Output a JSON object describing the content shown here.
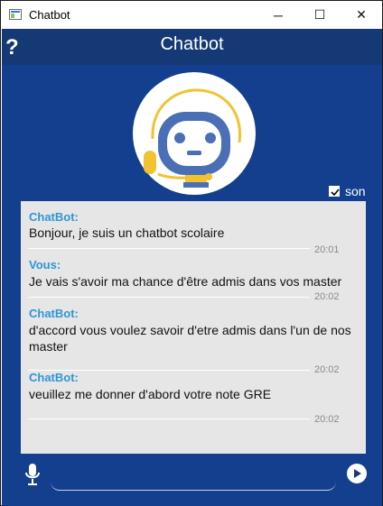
{
  "window": {
    "title": "Chatbot",
    "icon": "app-window-icon",
    "controls": {
      "minimize": "─",
      "maximize": "☐",
      "close": "✕"
    }
  },
  "header": {
    "title": "Chatbot",
    "help_label": "?",
    "background": "#153975"
  },
  "avatar": {
    "icon": "robot-headset-icon"
  },
  "sound": {
    "label": "son",
    "checked": true
  },
  "messages": [
    {
      "sender": "ChatBot:",
      "text": "Bonjour, je suis un chatbot scolaire",
      "time": "20:01"
    },
    {
      "sender": "Vous:",
      "text": "Je vais s'avoir ma chance d'être admis dans vos master",
      "time": "20:02"
    },
    {
      "sender": "ChatBot:",
      "text": "d'accord vous voulez savoir d'etre admis dans l'un de nos master",
      "time": "20:02"
    },
    {
      "sender": "ChatBot:",
      "text": "veuillez me donner d'abord votre note GRE",
      "time": "20:02"
    }
  ],
  "composer": {
    "value": "",
    "mic_icon": "microphone-icon",
    "send_icon": "play-send-icon"
  },
  "colors": {
    "app_background": "#143f8f",
    "chat_background": "#e6e6e6",
    "sender_color": "#2f95d5",
    "robot_blue": "#4a6fb5",
    "robot_yellow": "#f2c230"
  }
}
